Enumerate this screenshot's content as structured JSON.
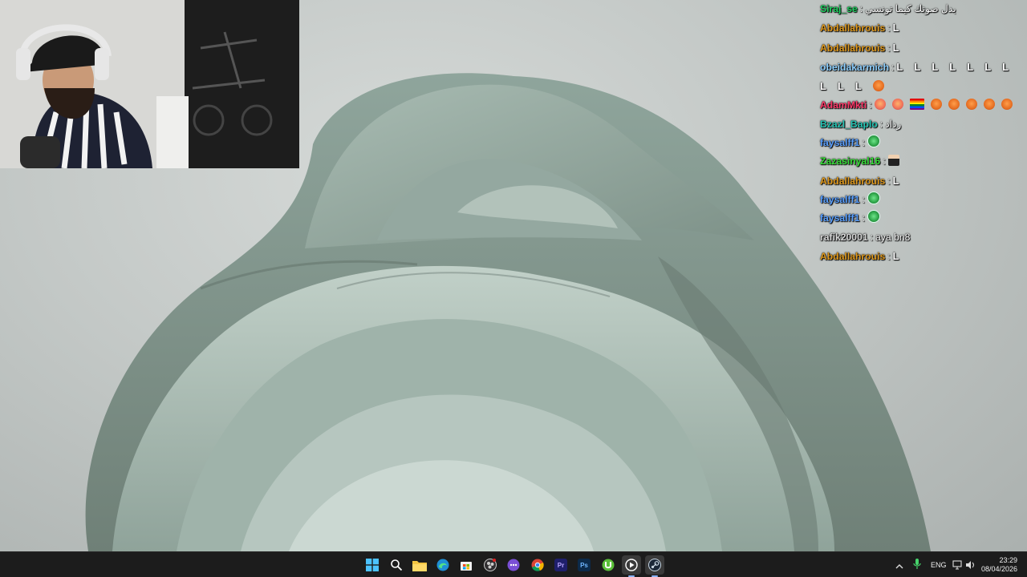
{
  "chat": {
    "messages": [
      {
        "user": "Siraj_se",
        "color": "#20d060",
        "sep": ":",
        "text": "بدل صوتك كيما تونسي"
      },
      {
        "user": "Abdallahrouis",
        "color": "#e09a1e",
        "sep": ":",
        "emotes": [
          "L"
        ]
      },
      {
        "user": "Abdallahrouis",
        "color": "#e09a1e",
        "sep": ":",
        "emotes": [
          "L"
        ]
      },
      {
        "user": "obeidakarmich",
        "color": "#8fd0ff",
        "sep": ":",
        "emotes": [
          "L",
          "L",
          "L",
          "L",
          "L",
          "L",
          "L",
          "L",
          "L",
          "L",
          "angry"
        ]
      },
      {
        "user": "AdamMkti",
        "color": "#ff3b6b",
        "sep": ":",
        "emotes": [
          "flushed",
          "flushed",
          "flag",
          "angry",
          "angry",
          "angry",
          "angry",
          "angry"
        ]
      },
      {
        "user": "Bzazl_Baplo",
        "color": "#28c7b7",
        "sep": ":",
        "text": "رداد"
      },
      {
        "user": "faysalff1",
        "color": "#5aa0ff",
        "sep": ":",
        "emotes": [
          "alien"
        ]
      },
      {
        "user": "Zazasinyal16",
        "color": "#38e038",
        "sep": ":",
        "emotes": [
          "man"
        ]
      },
      {
        "user": "Abdallahrouis",
        "color": "#e09a1e",
        "sep": ":",
        "emotes": [
          "L"
        ]
      },
      {
        "user": "faysalff1",
        "color": "#5aa0ff",
        "sep": ":",
        "emotes": [
          "alien"
        ]
      },
      {
        "user": "faysalff1",
        "color": "#5aa0ff",
        "sep": ":",
        "emotes": [
          "alien"
        ]
      },
      {
        "user": "rafik20001",
        "color": "#d8d8d8",
        "sep": ":",
        "text": "aya bn8"
      },
      {
        "user": "Abdallahrouis",
        "color": "#e09a1e",
        "sep": ":",
        "emotes": [
          "L"
        ]
      }
    ]
  },
  "taskbar": {
    "apps": [
      {
        "name": "start-button",
        "icon": "windows-logo",
        "color": "#3aa0ff"
      },
      {
        "name": "search-button",
        "icon": "search-icon",
        "color": "#ffffff"
      },
      {
        "name": "file-explorer",
        "icon": "folder-icon",
        "color": "#f4c542"
      },
      {
        "name": "edge-browser",
        "icon": "edge-icon",
        "color": "#2aa5e0"
      },
      {
        "name": "microsoft-store",
        "icon": "store-icon",
        "color": "#ffffff"
      },
      {
        "name": "obs-studio",
        "icon": "obs-icon",
        "color": "#2b2b2b"
      },
      {
        "name": "chat-app",
        "icon": "chat-icon",
        "color": "#7a4fd6"
      },
      {
        "name": "chrome-browser",
        "icon": "chrome-icon",
        "color": "#e33b2e"
      },
      {
        "name": "premiere-pro",
        "icon": "premiere-icon",
        "color": "#1f1f6b",
        "label": "Pr"
      },
      {
        "name": "photoshop",
        "icon": "photoshop-icon",
        "color": "#0c2a4a",
        "label": "Ps"
      },
      {
        "name": "utorrent",
        "icon": "utorrent-icon",
        "color": "#5bbf3a"
      },
      {
        "name": "media-player",
        "icon": "play-icon",
        "color": "#c0392b"
      },
      {
        "name": "steam",
        "icon": "steam-icon",
        "color": "#1b2838"
      }
    ],
    "tray": {
      "language": "ENG",
      "time": "23:29",
      "date": "08/04/2026"
    }
  }
}
